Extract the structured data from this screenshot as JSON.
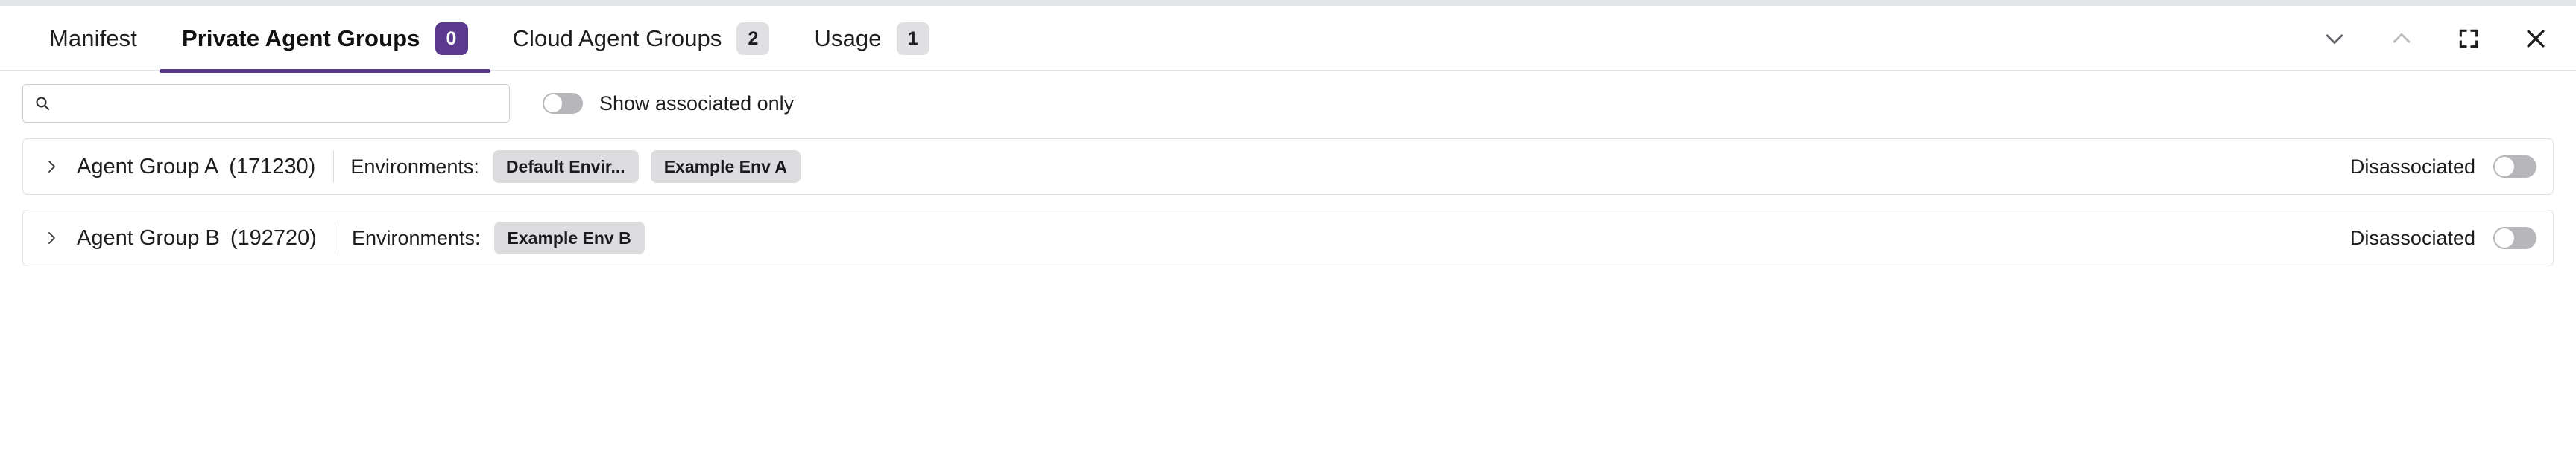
{
  "window": {
    "controls": [
      {
        "name": "chevron-down-icon",
        "label": "Collapse",
        "state": "enabled"
      },
      {
        "name": "chevron-up-icon",
        "label": "Expand",
        "state": "disabled"
      },
      {
        "name": "fullscreen-icon",
        "label": "Maximize",
        "state": "enabled"
      },
      {
        "name": "close-icon",
        "label": "Close",
        "state": "enabled"
      }
    ]
  },
  "colors": {
    "accent": "#5b3a8e",
    "badge_neutral_bg": "#e0e0e2",
    "chip_bg": "#dddde0",
    "switch_off": "#b7b7bb",
    "top_strip": "#e4e5e7",
    "border": "#e0e0e3"
  },
  "tabs": [
    {
      "label": "Manifest",
      "badge": null,
      "active": false
    },
    {
      "label": "Private Agent Groups",
      "badge": "0",
      "active": true,
      "badge_style": "accent"
    },
    {
      "label": "Cloud Agent Groups",
      "badge": "2",
      "active": false,
      "badge_style": "neutral"
    },
    {
      "label": "Usage",
      "badge": "1",
      "active": false,
      "badge_style": "neutral"
    }
  ],
  "filter": {
    "search_value": "",
    "search_placeholder": "",
    "search_icon": "search-icon",
    "toggle_label": "Show associated only",
    "toggle_state": "off"
  },
  "groups": [
    {
      "expand_icon": "chevron-right-icon",
      "name": "Agent Group A",
      "id": "(171230)",
      "environments_label": "Environments:",
      "chips": [
        "Default Envir...",
        "Example Env A"
      ],
      "association_label": "Disassociated",
      "association_state": "off"
    },
    {
      "expand_icon": "chevron-right-icon",
      "name": "Agent Group B",
      "id": "(192720)",
      "environments_label": "Environments:",
      "chips": [
        "Example Env B"
      ],
      "association_label": "Disassociated",
      "association_state": "off"
    }
  ]
}
